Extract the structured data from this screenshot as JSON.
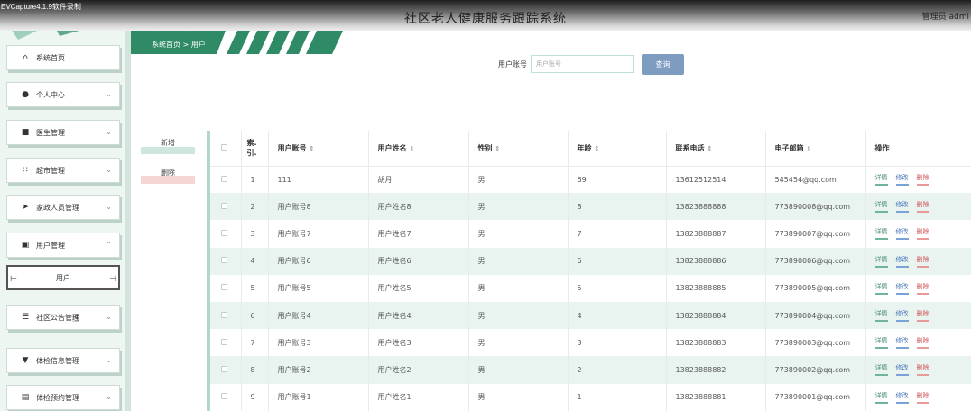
{
  "watermark": "EVCapture4.1.9软件录制",
  "app_title": "社区老人健康服务跟踪系统",
  "admin_label": "管理员 admi",
  "sidebar": {
    "items": [
      {
        "label": "系统首页",
        "icon": "home-icon"
      },
      {
        "label": "个人中心",
        "icon": "person-icon"
      },
      {
        "label": "医生管理",
        "icon": "doctor-icon"
      },
      {
        "label": "超市管理",
        "icon": "grid-icon"
      },
      {
        "label": "家政人员管理",
        "icon": "send-icon"
      },
      {
        "label": "用户管理",
        "icon": "briefcase-icon"
      },
      {
        "label": "社区公告管理",
        "icon": "list-icon"
      },
      {
        "label": "体检信息管理",
        "icon": "trophy-icon"
      },
      {
        "label": "体检预约管理",
        "icon": "clipboard-icon"
      }
    ],
    "sub_item": "用户"
  },
  "breadcrumb": {
    "home": "系统首页",
    "sep": ">",
    "current": "用户"
  },
  "search": {
    "label": "用户账号",
    "placeholder": "用户账号",
    "button": "查询"
  },
  "actions": {
    "add": "新增",
    "delete": "删除"
  },
  "table": {
    "columns": [
      "索引",
      "用户账号",
      "用户姓名",
      "性别",
      "年龄",
      "联系电话",
      "电子邮箱",
      "操作"
    ],
    "index_header_lines": [
      "索.",
      "引."
    ],
    "row_actions": {
      "detail": "详情",
      "edit": "修改",
      "delete": "删除"
    },
    "rows": [
      {
        "index": "1",
        "account": "111",
        "name": "胡月",
        "gender": "男",
        "age": "69",
        "phone": "13612512514",
        "email": "545454@qq.com"
      },
      {
        "index": "2",
        "account": "用户账号8",
        "name": "用户姓名8",
        "gender": "男",
        "age": "8",
        "phone": "13823888888",
        "email": "773890008@qq.com"
      },
      {
        "index": "3",
        "account": "用户账号7",
        "name": "用户姓名7",
        "gender": "男",
        "age": "7",
        "phone": "13823888887",
        "email": "773890007@qq.com"
      },
      {
        "index": "4",
        "account": "用户账号6",
        "name": "用户姓名6",
        "gender": "男",
        "age": "6",
        "phone": "13823888886",
        "email": "773890006@qq.com"
      },
      {
        "index": "5",
        "account": "用户账号5",
        "name": "用户姓名5",
        "gender": "男",
        "age": "5",
        "phone": "13823888885",
        "email": "773890005@qq.com"
      },
      {
        "index": "6",
        "account": "用户账号4",
        "name": "用户姓名4",
        "gender": "男",
        "age": "4",
        "phone": "13823888884",
        "email": "773890004@qq.com"
      },
      {
        "index": "7",
        "account": "用户账号3",
        "name": "用户姓名3",
        "gender": "男",
        "age": "3",
        "phone": "13823888883",
        "email": "773890003@qq.com"
      },
      {
        "index": "8",
        "account": "用户账号2",
        "name": "用户姓名2",
        "gender": "男",
        "age": "2",
        "phone": "13823888882",
        "email": "773890002@qq.com"
      },
      {
        "index": "9",
        "account": "用户账号1",
        "name": "用户姓名1",
        "gender": "男",
        "age": "1",
        "phone": "13823888881",
        "email": "773890001@qq.com"
      }
    ]
  },
  "colors": {
    "accent": "#2f8a66",
    "header_dark": "#1e1e1e",
    "search_button": "#7d9cc0",
    "row_stripe": "#e9f4f0"
  }
}
